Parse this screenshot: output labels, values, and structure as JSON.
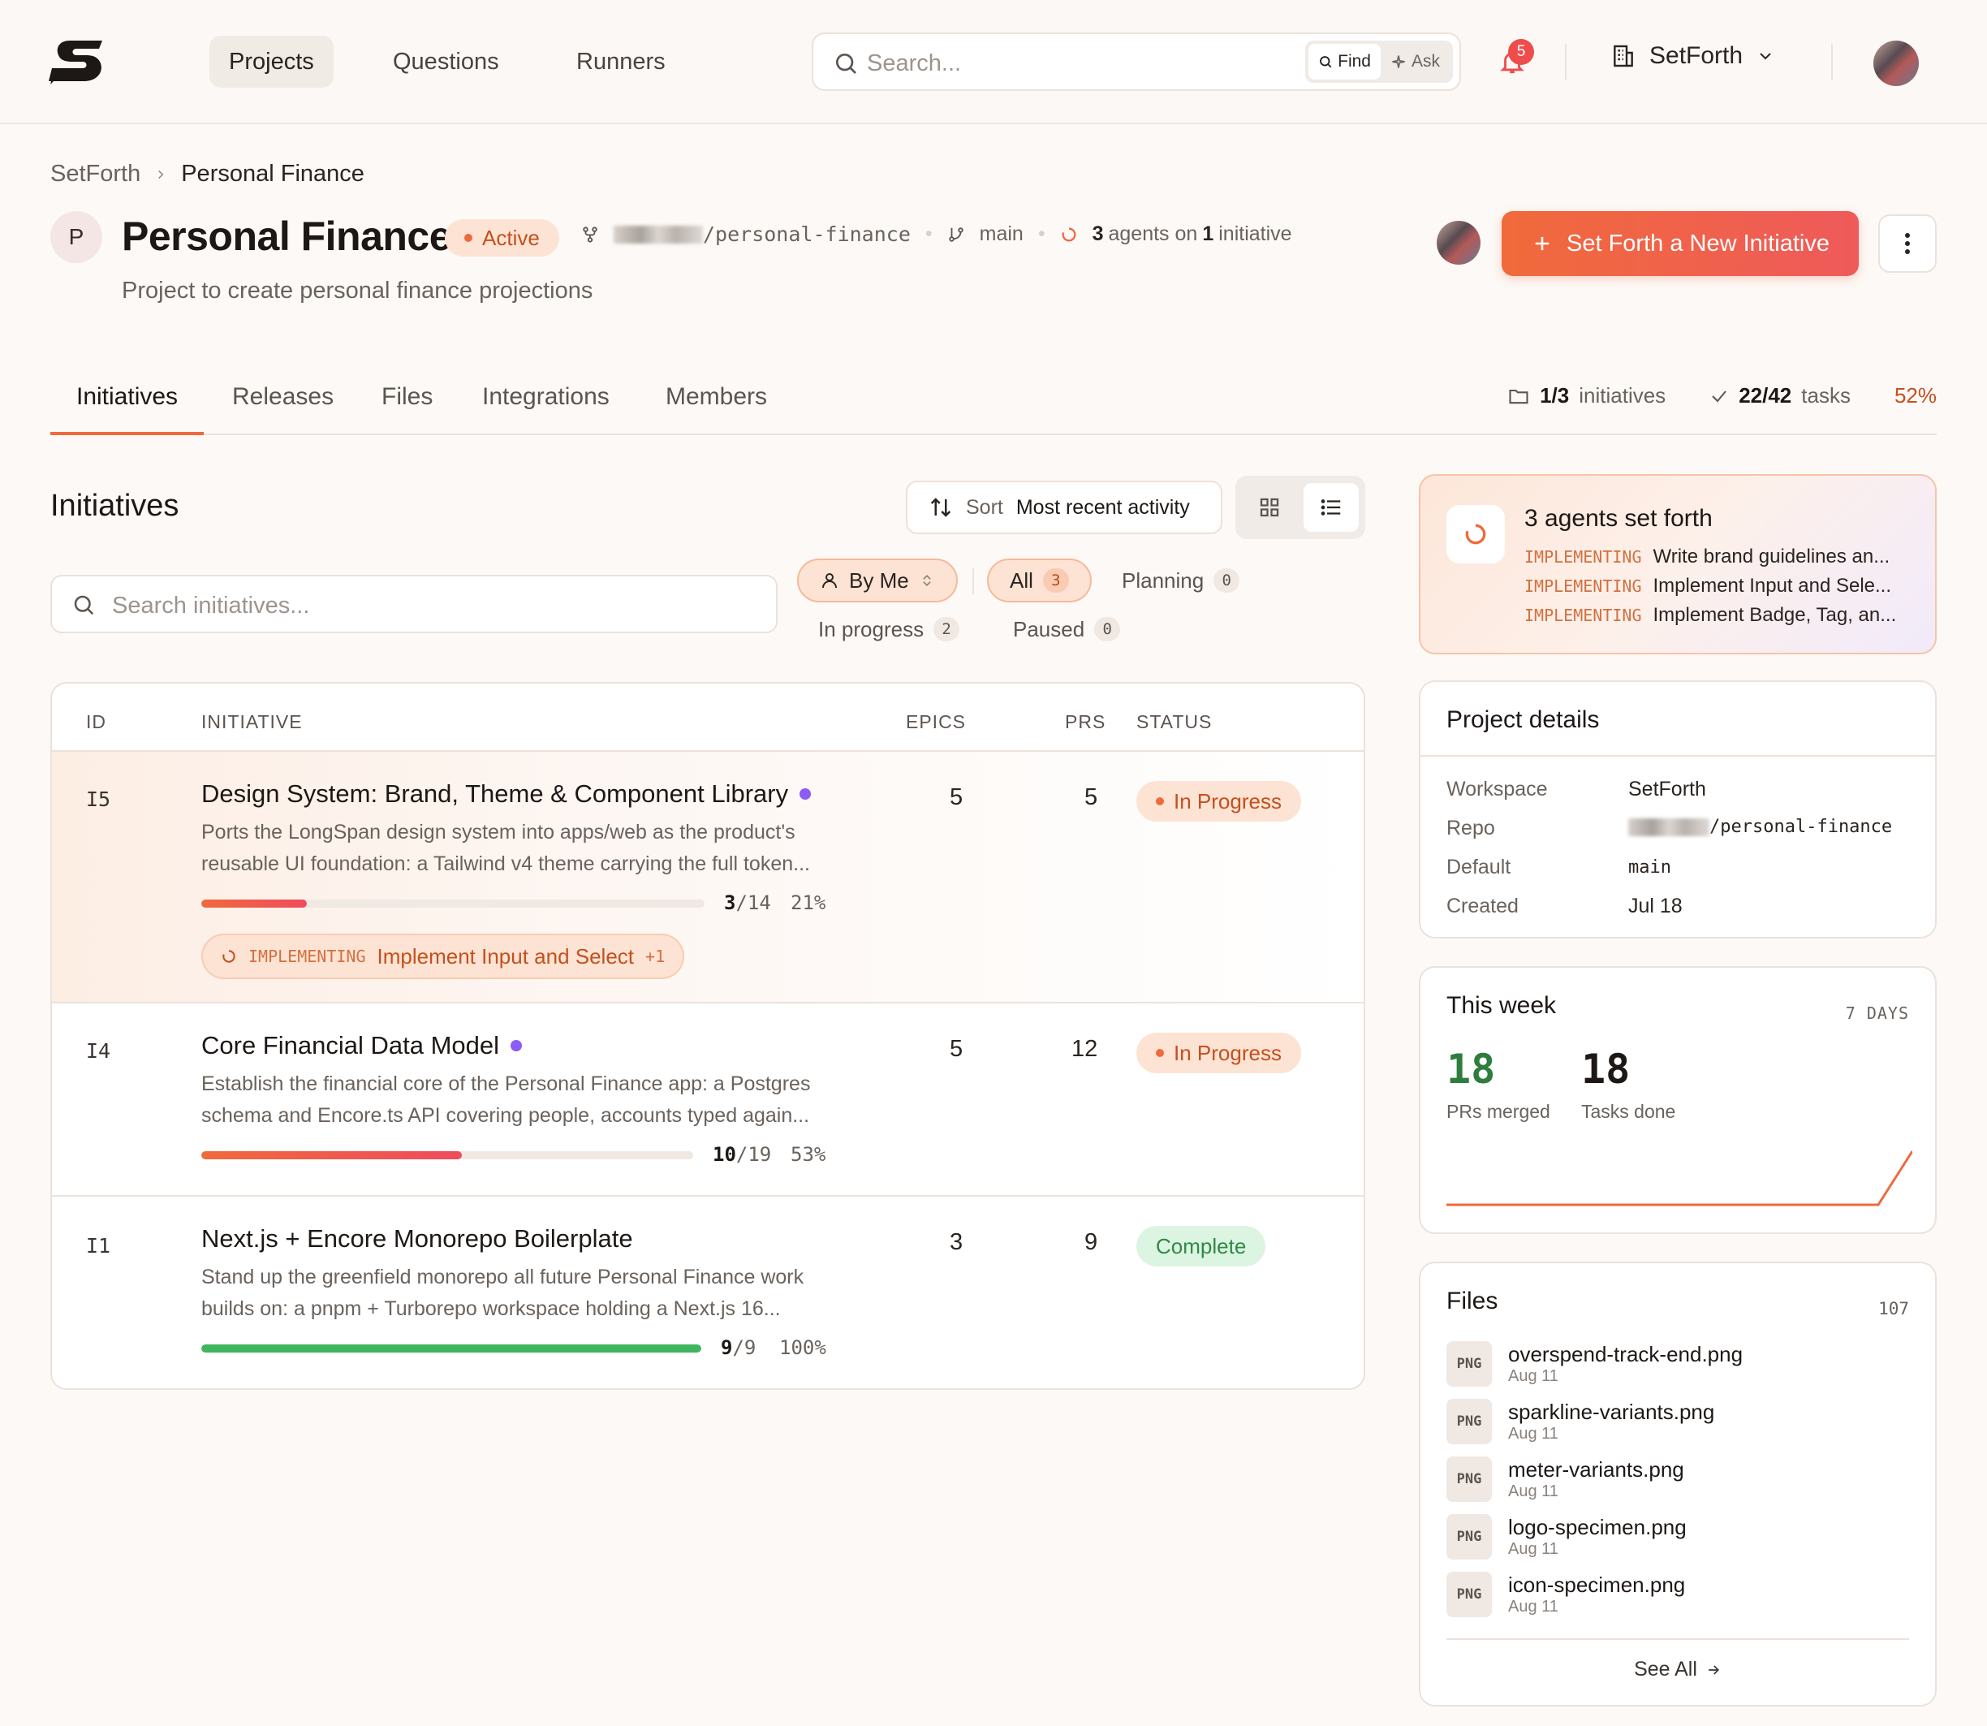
{
  "nav": {
    "items": [
      "Projects",
      "Questions",
      "Runners"
    ],
    "search_placeholder": "Search...",
    "find_label": "Find",
    "ask_label": "Ask",
    "notif_count": "5",
    "org_name": "SetForth"
  },
  "breadcrumb": {
    "root": "SetForth",
    "current": "Personal Finance"
  },
  "project": {
    "initial": "P",
    "title": "Personal Finance",
    "status": "Active",
    "repo_suffix": "/personal-finance",
    "branch": "main",
    "agents_count": "3",
    "agents_text": "agents on",
    "initiative_count": "1",
    "initiative_text": "initiative",
    "description": "Project to create personal finance projections",
    "cta_label": "Set Forth a New Initiative"
  },
  "tabs": [
    "Initiatives",
    "Releases",
    "Files",
    "Integrations",
    "Members"
  ],
  "stats": {
    "initiatives_value": "1/3",
    "initiatives_label": "initiatives",
    "tasks_value": "22/42",
    "tasks_label": "tasks",
    "percent": "52%"
  },
  "initiatives": {
    "title": "Initiatives",
    "sort_label": "Sort",
    "sort_value": "Most recent activity",
    "search_placeholder": "Search initiatives...",
    "filters": {
      "by_me": "By Me",
      "all": "All",
      "all_count": "3",
      "planning": "Planning",
      "planning_count": "0",
      "in_progress": "In progress",
      "in_progress_count": "2",
      "paused": "Paused",
      "paused_count": "0"
    },
    "columns": [
      "ID",
      "INITIATIVE",
      "EPICS",
      "PRS",
      "STATUS"
    ],
    "rows": [
      {
        "id": "I5",
        "title": "Design System: Brand, Theme & Component Library",
        "desc1": "Ports the LongSpan design system into apps/web as the product's",
        "desc2": "reusable UI foundation: a Tailwind v4 theme carrying the full token...",
        "epics": "5",
        "prs": "5",
        "status": "In Progress",
        "done": "3",
        "total": "/14",
        "pct": "21%",
        "progress": 0.21,
        "impl_tag": "IMPLEMENTING",
        "impl_text": "Implement Input and Select",
        "impl_more": "+1"
      },
      {
        "id": "I4",
        "title": "Core Financial Data Model",
        "desc1": "Establish the financial core of the Personal Finance app: a Postgres",
        "desc2": "schema and Encore.ts API covering people, accounts typed again...",
        "epics": "5",
        "prs": "12",
        "status": "In Progress",
        "done": "10",
        "total": "/19",
        "pct": "53%",
        "progress": 0.53
      },
      {
        "id": "I1",
        "title": "Next.js + Encore Monorepo Boilerplate",
        "desc1": "Stand up the greenfield monorepo all future Personal Finance work",
        "desc2": "builds on: a pnpm + Turborepo workspace holding a Next.js 16...",
        "epics": "3",
        "prs": "9",
        "status": "Complete",
        "done": "9",
        "total": "/9",
        "pct": "100%",
        "progress": 1.0
      }
    ]
  },
  "agents_card": {
    "title": "3 agents set forth",
    "tag": "IMPLEMENTING",
    "lines": [
      "Write brand guidelines an...",
      "Implement Input and Sele...",
      "Implement Badge, Tag, an..."
    ]
  },
  "details": {
    "title": "Project details",
    "workspace_label": "Workspace",
    "workspace": "SetForth",
    "repo_label": "Repo",
    "repo_suffix": "/personal-finance",
    "default_label": "Default",
    "default": "main",
    "created_label": "Created",
    "created": "Jul 18"
  },
  "week": {
    "title": "This week",
    "range": "7 DAYS",
    "prs_value": "18",
    "prs_label": "PRs merged",
    "tasks_value": "18",
    "tasks_label": "Tasks done"
  },
  "files": {
    "title": "Files",
    "count": "107",
    "type": "PNG",
    "items": [
      {
        "name": "overspend-track-end.png",
        "date": "Aug 11"
      },
      {
        "name": "sparkline-variants.png",
        "date": "Aug 11"
      },
      {
        "name": "meter-variants.png",
        "date": "Aug 11"
      },
      {
        "name": "logo-specimen.png",
        "date": "Aug 11"
      },
      {
        "name": "icon-specimen.png",
        "date": "Aug 11"
      }
    ],
    "see_all": "See All"
  },
  "colors": {
    "accent": "#ef6a3c",
    "progress_fill": "#ef5a4a",
    "complete": "#3fb55e",
    "purple": "#8b5cf6"
  }
}
